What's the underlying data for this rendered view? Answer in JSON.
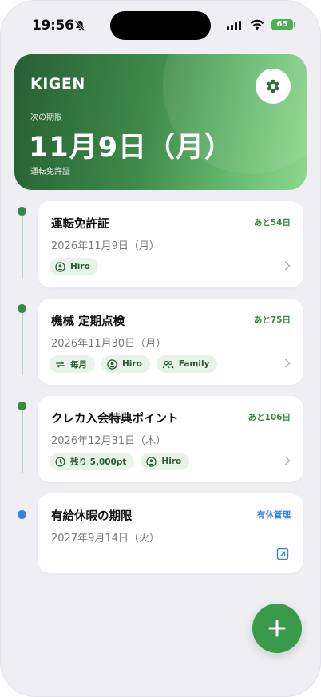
{
  "status_bar": {
    "time": "19:56",
    "battery": "65"
  },
  "header": {
    "app_title": "KIGEN",
    "next_label": "次の期限",
    "next_date": "11月9日（月）",
    "next_item": "運転免許証"
  },
  "items": [
    {
      "title": "運転免許証",
      "date": "2026年11月9日（月）",
      "remaining": "あと54日",
      "chips": [
        {
          "icon": "person-icon",
          "label": "Hiro"
        }
      ]
    },
    {
      "title": "機械 定期点検",
      "date": "2026年11月30日（月）",
      "remaining": "あと75日",
      "chips": [
        {
          "icon": "repeat-icon",
          "label": "毎月"
        },
        {
          "icon": "person-icon",
          "label": "Hiro"
        },
        {
          "icon": "group-icon",
          "label": "Family"
        }
      ]
    },
    {
      "title": "クレカ入会特典ポイント",
      "date": "2026年12月31日（木）",
      "remaining": "あと106日",
      "chips": [
        {
          "icon": "clock-icon",
          "label": "残り 5,000pt"
        },
        {
          "icon": "person-icon",
          "label": "Hiro"
        }
      ]
    },
    {
      "title": "有給休暇の期限",
      "date": "2027年9月14日（火）",
      "remaining": "有休管理",
      "chips": []
    }
  ],
  "colors": {
    "accent": "#3a8a47",
    "link_blue": "#3b7fe0",
    "chip_bg": "#e7f3e8"
  }
}
